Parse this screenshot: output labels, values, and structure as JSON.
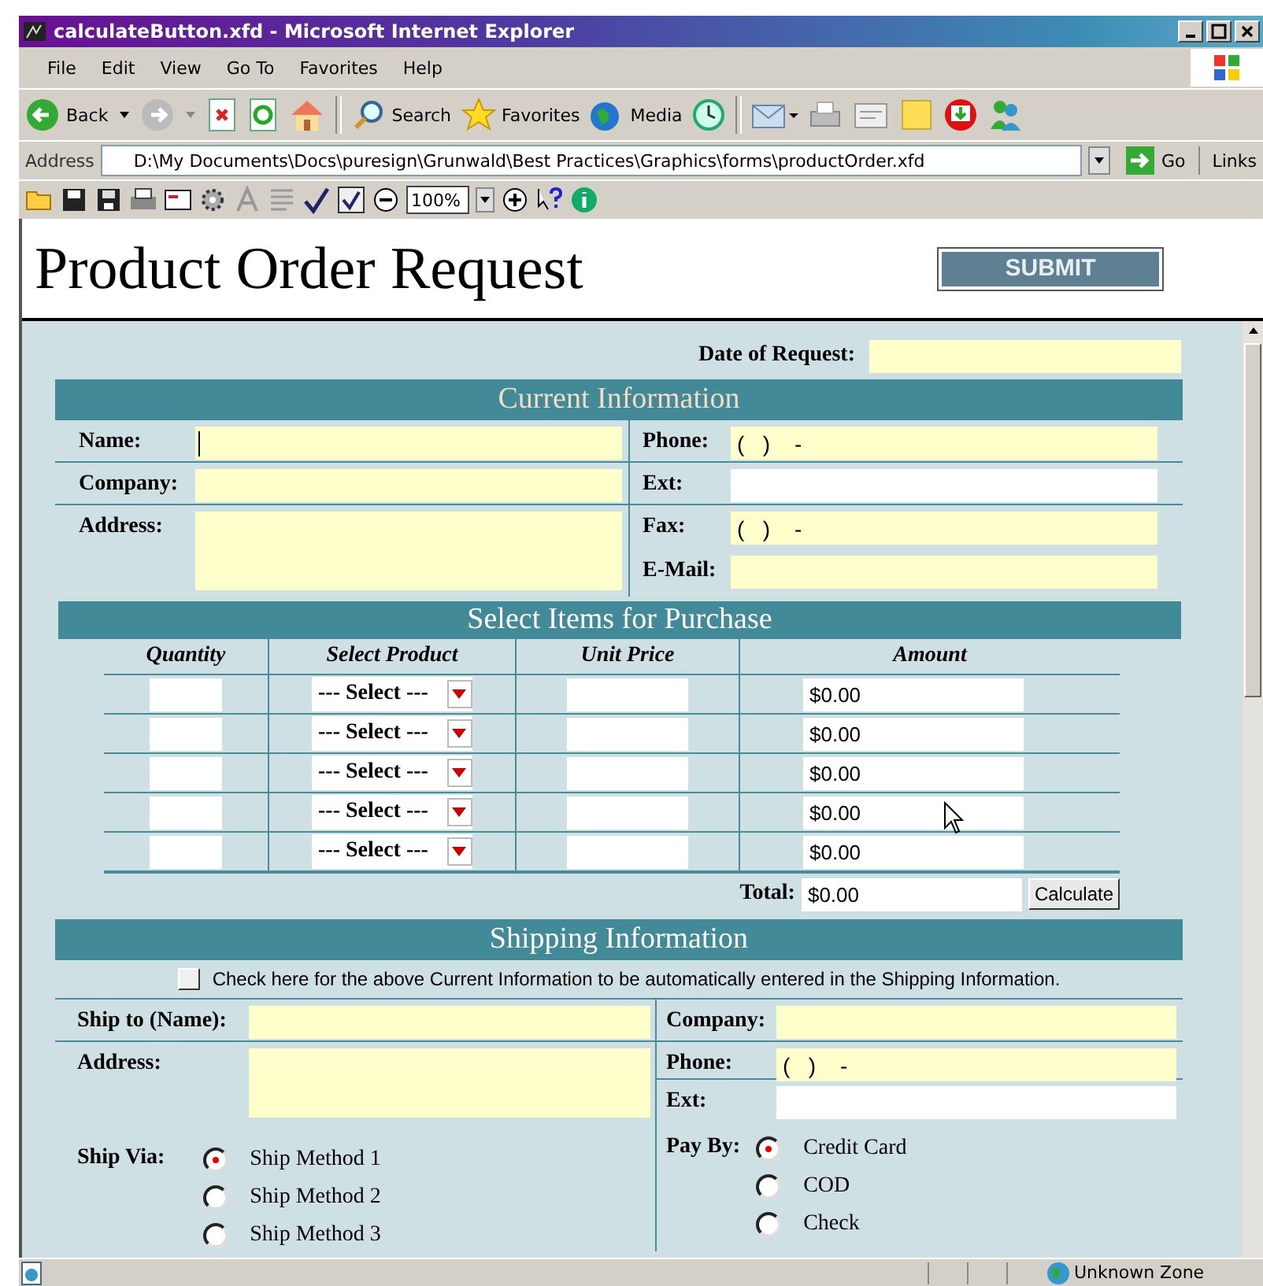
{
  "window": {
    "title": "calculateButton.xfd - Microsoft Internet Explorer"
  },
  "menu": [
    "File",
    "Edit",
    "View",
    "Go To",
    "Favorites",
    "Help"
  ],
  "toolbar": {
    "back": "Back",
    "search": "Search",
    "favorites": "Favorites",
    "media": "Media"
  },
  "address_bar": {
    "label": "Address",
    "url": "D:\\My Documents\\Docs\\puresign\\Grunwald\\Best Practices\\Graphics\\forms\\productOrder.xfd",
    "go": "Go",
    "links": "Links"
  },
  "form_toolbar": {
    "zoom": "100%"
  },
  "form": {
    "title": "Product Order Request",
    "submit": "SUBMIT",
    "date_label": "Date of Request:",
    "current": {
      "heading": "Current Information",
      "name_label": "Name:",
      "company_label": "Company:",
      "address_label": "Address:",
      "phone_label": "Phone:",
      "phone_value": "(   )    -",
      "ext_label": "Ext:",
      "fax_label": "Fax:",
      "fax_value": "(   )    -",
      "email_label": "E-Mail:"
    },
    "items": {
      "heading": "Select Items for Purchase",
      "columns": [
        "Quantity",
        "Select Product",
        "Unit Price",
        "Amount"
      ],
      "rows": [
        {
          "product": "--- Select ---",
          "amount": "$0.00"
        },
        {
          "product": "--- Select ---",
          "amount": "$0.00"
        },
        {
          "product": "--- Select ---",
          "amount": "$0.00"
        },
        {
          "product": "--- Select ---",
          "amount": "$0.00"
        },
        {
          "product": "--- Select ---",
          "amount": "$0.00"
        }
      ],
      "total_label": "Total:",
      "total": "$0.00",
      "calculate": "Calculate"
    },
    "shipping": {
      "heading": "Shipping Information",
      "copy_checkbox": {
        "label": "Check here for the above Current Information to be automatically entered in the Shipping Information.",
        "checked": false
      },
      "ship_to_label": "Ship to (Name):",
      "address_label": "Address:",
      "company_label": "Company:",
      "phone_label": "Phone:",
      "phone_value": "(   )    -",
      "ext_label": "Ext:",
      "ship_via": {
        "label": "Ship Via:",
        "options": [
          {
            "label": "Ship Method 1",
            "selected": true
          },
          {
            "label": "Ship Method 2",
            "selected": false
          },
          {
            "label": "Ship Method 3",
            "selected": false
          }
        ]
      },
      "pay_by": {
        "label": "Pay By:",
        "options": [
          {
            "label": "Credit Card",
            "selected": true
          },
          {
            "label": "COD",
            "selected": false
          },
          {
            "label": "Check",
            "selected": false
          }
        ]
      }
    }
  },
  "status_bar": {
    "zone": "Unknown Zone"
  }
}
